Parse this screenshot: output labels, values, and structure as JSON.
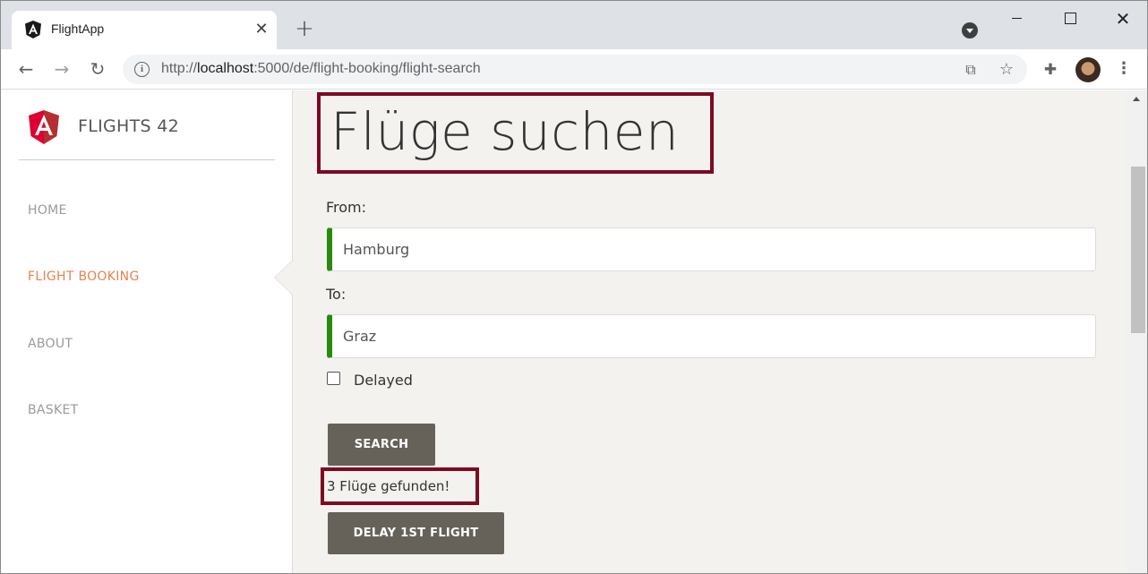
{
  "browser": {
    "tab_title": "FlightApp",
    "tab_close": "✕",
    "new_tab": "+",
    "url_prefix": "http://",
    "url_host": "localhost",
    "url_path": ":5000/de/flight-booking/flight-search"
  },
  "app": {
    "brand": "FLIGHTS 42",
    "accent_color": "#e4834d",
    "nav": [
      {
        "label": "HOME"
      },
      {
        "label": "FLIGHT BOOKING"
      },
      {
        "label": "ABOUT"
      },
      {
        "label": "BASKET"
      }
    ]
  },
  "search": {
    "title": "Flüge suchen",
    "from_label": "From:",
    "from_value": "Hamburg",
    "to_label": "To:",
    "to_value": "Graz",
    "delayed_label": "Delayed",
    "search_button": "SEARCH",
    "result_text": "3 Flüge gefunden!",
    "delay_button": "DELAY 1ST FLIGHT"
  },
  "colors": {
    "highlight_border": "#7d0a22",
    "valid_border": "#2a8a0e",
    "button_bg": "#66625a"
  }
}
